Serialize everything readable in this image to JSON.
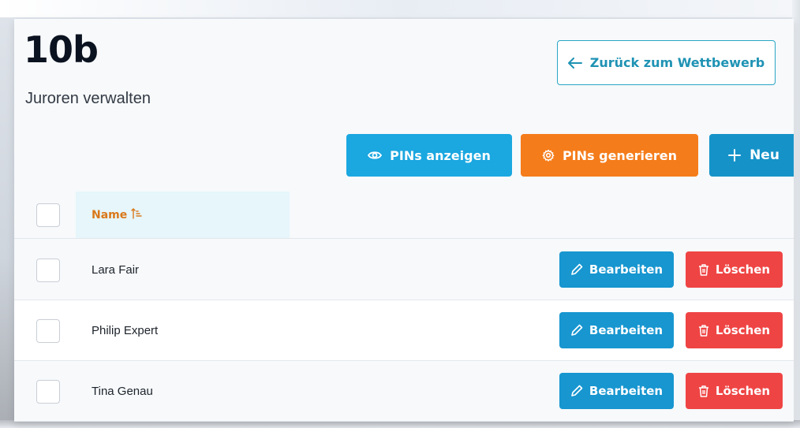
{
  "page": {
    "title": "10b",
    "subtitle": "Juroren verwalten"
  },
  "toolbar": {
    "back_label": "Zurück zum Wettbewerb",
    "show_pins_label": "PINs anzeigen",
    "generate_pins_label": "PINs generieren",
    "new_label": "Neu"
  },
  "table": {
    "columns": [
      "Name"
    ],
    "sort": "ascending",
    "rows": [
      {
        "name": "Lara Fair",
        "edit_label": "Bearbeiten",
        "delete_label": "Löschen"
      },
      {
        "name": "Philip Expert",
        "edit_label": "Bearbeiten",
        "delete_label": "Löschen"
      },
      {
        "name": "Tina Genau",
        "edit_label": "Bearbeiten",
        "delete_label": "Löschen"
      }
    ]
  },
  "icons": {
    "back": "arrow-left-icon",
    "show_pins": "eye-icon",
    "generate_pins": "gear-icon",
    "new": "plus-icon",
    "sort": "sort-ascending-icon",
    "edit": "pencil-icon",
    "delete": "trash-icon"
  },
  "colors": {
    "primary": "#1ba7e0",
    "warning": "#f57c1a",
    "danger": "#ef4444",
    "sort_header": "#d9781a"
  }
}
